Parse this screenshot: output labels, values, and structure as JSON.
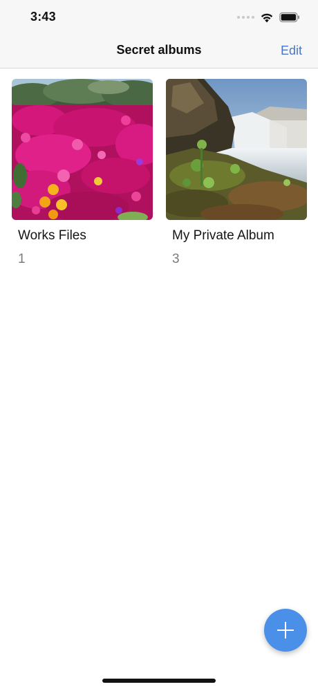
{
  "status_bar": {
    "time": "3:43",
    "icons": [
      "signal-dots-icon",
      "wifi-icon",
      "battery-icon"
    ]
  },
  "nav": {
    "title": "Secret albums",
    "edit_label": "Edit"
  },
  "albums": [
    {
      "title": "Works Files",
      "count": "1",
      "thumbnail": "pink-flowers-photo"
    },
    {
      "title": "My Private Album",
      "count": "3",
      "thumbnail": "waterfall-photo"
    }
  ],
  "fab": {
    "icon": "plus-icon"
  },
  "colors": {
    "accent": "#4a74c9",
    "fab": "#4a90e8",
    "bar_background": "#f7f7f7",
    "count_text": "#7b7b7b"
  }
}
